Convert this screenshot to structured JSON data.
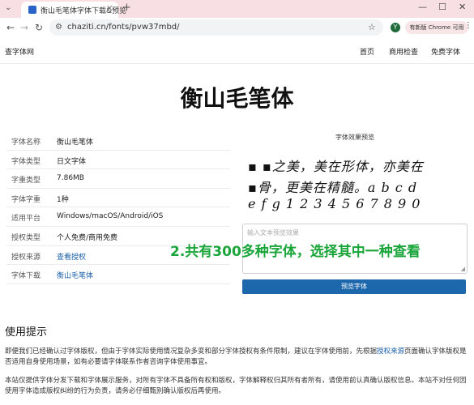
{
  "browser": {
    "tab_title": "衡山毛笔体字体下载&预览",
    "address": "chaziti.cn/fonts/pvw37mbd/",
    "profile_initial": "Y",
    "update_label": "有新版 Chrome 可用",
    "new_tab": "+",
    "close_tab": "×",
    "min": "—",
    "max": "☐",
    "close": "✕"
  },
  "site": {
    "logo": "查字体网",
    "nav": [
      "首页",
      "商用检查",
      "免费字体"
    ]
  },
  "page": {
    "title": "衡山毛笔体"
  },
  "info": [
    {
      "key": "字体名称",
      "value": "衡山毛笔体"
    },
    {
      "key": "字体类型",
      "value": "日文字体"
    },
    {
      "key": "字重类型",
      "value": "7.86MB"
    },
    {
      "key": "字体字重",
      "value": "1种"
    },
    {
      "key": "适用平台",
      "value": "Windows/macOS/Android/iOS"
    },
    {
      "key": "授权类型",
      "value": "个人免费/商用免费"
    },
    {
      "key": "授权来源",
      "value": "查看授权"
    },
    {
      "key": "字体下载",
      "value": "衡山毛笔体"
    }
  ],
  "preview": {
    "label": "字体效果预览",
    "lines": [
      "▪ ▪之美，美在形体，亦美在",
      "▪骨，更美在精髓。a b c d",
      "e f g 1 2 3 4 5 6 7 8 9 0"
    ],
    "placeholder": "输入文本预览效果",
    "button": "预览字体"
  },
  "overlay_text": "2.共有300多种字体，选择其中一种查看",
  "tips": {
    "title": "使用提示",
    "p1_a": "即便我们已经确认过字体版权，但由于字体实际使用情况复杂多变和部分字体授权有条件限制，建议在字体使用前，先根据",
    "p1_link": "授权来源",
    "p1_b": "页面确认字体版权是否适用自身使用场景，如有必要请字体联系作者咨询字体使用事宜。",
    "p2": "本站仅提供字体分发下载和字体展示服务，对所有字体不具备所有权和版权，字体解释权归其所有者所有，请使用前认真确认版权信息。本站不对任何因使用字体造成版权纠纷的行为负责，请务必仔细甄别确认版权后再使用。"
  }
}
